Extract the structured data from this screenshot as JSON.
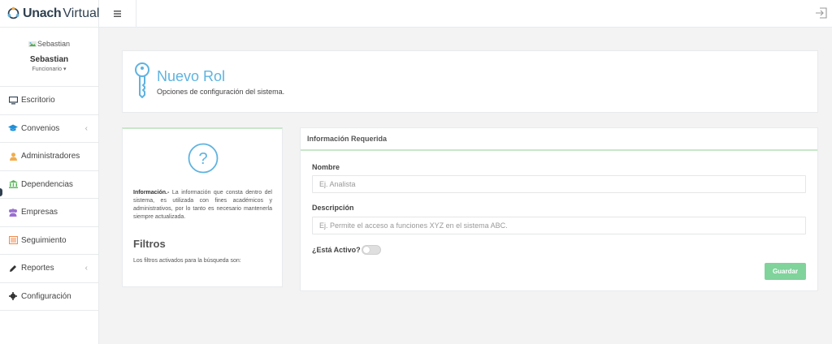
{
  "brand": {
    "name_bold": "Unach",
    "name_light": "Virtual"
  },
  "profile": {
    "image_alt": "Sebastian",
    "name": "Sebastian",
    "role": "Funcionario ▾"
  },
  "sidebar": {
    "items": [
      {
        "label": "Escritorio",
        "icon": "desktop-icon"
      },
      {
        "label": "Convenios",
        "icon": "graduation-cap-icon",
        "chevron": "‹"
      },
      {
        "label": "Administradores",
        "icon": "user-icon"
      },
      {
        "label": "Dependencias",
        "icon": "institution-icon"
      },
      {
        "label": "Empresas",
        "icon": "users-icon"
      },
      {
        "label": "Seguimiento",
        "icon": "list-alt-icon"
      },
      {
        "label": "Reportes",
        "icon": "pencil-icon",
        "chevron": "‹"
      },
      {
        "label": "Configuración",
        "icon": "gear-icon"
      }
    ]
  },
  "topbar": {
    "menu_icon": "hamburger-icon",
    "logout_icon": "sign-out-icon"
  },
  "header": {
    "title": "Nuevo Rol",
    "subtitle": "Opciones de configuración del sistema.",
    "icon": "key-icon"
  },
  "info": {
    "icon": "question-circle-icon",
    "lead": "Información.-",
    "text": " La información que consta dentro del sistema, es utilizada con fines académicos y administrativos, por lo tanto es necesario mantenerla siempre actualizada.",
    "filters_title": "Filtros",
    "filters_text": "Los filtros activados para la búsqueda son:"
  },
  "form": {
    "header": "Información Requerida",
    "nombre_label": "Nombre",
    "nombre_placeholder": "Ej. Analista",
    "nombre_value": "",
    "descripcion_label": "Descripción",
    "descripcion_placeholder": "Ej. Permite el acceso a funciones XYZ en el sistema ABC.",
    "descripcion_value": "",
    "activo_label": "¿Está Activo?",
    "activo_value": false,
    "save_label": "Guardar"
  },
  "colors": {
    "accent_blue": "#5fb3e0",
    "save_green": "#7fd39b",
    "panel_border_green": "#c8e6c9"
  }
}
